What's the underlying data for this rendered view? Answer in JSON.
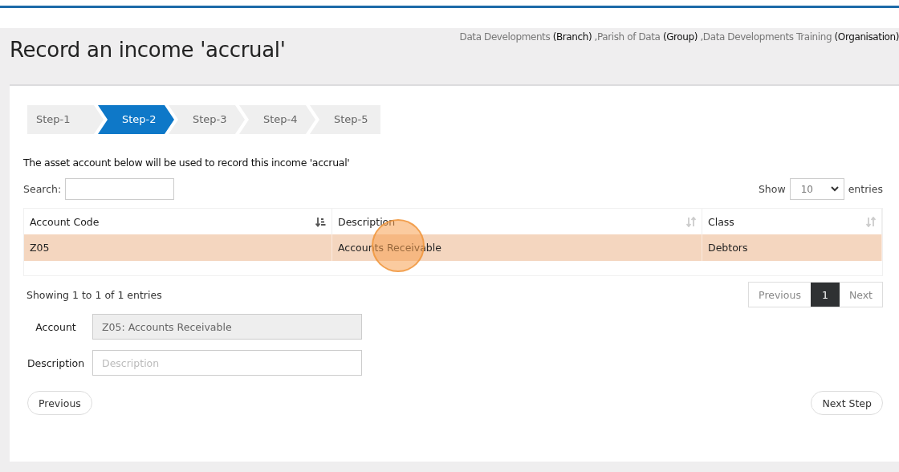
{
  "page": {
    "title": "Record an income 'accrual'"
  },
  "breadcrumb": [
    {
      "name": "Data Developments",
      "type": "(Branch)",
      "separator": ","
    },
    {
      "name": "Parish of Data",
      "type": "(Group)",
      "separator": ","
    },
    {
      "name": "Data Developments Training",
      "type": "(Organisation)"
    }
  ],
  "steps": [
    {
      "label": "Step-1",
      "selected": false
    },
    {
      "label": "Step-2",
      "selected": true
    },
    {
      "label": "Step-3",
      "selected": false
    },
    {
      "label": "Step-4",
      "selected": false
    },
    {
      "label": "Step-5",
      "selected": false
    }
  ],
  "intro": "The asset account below will be used to record this income 'accrual'",
  "search": {
    "label": "Search:"
  },
  "length": {
    "before": "Show",
    "value": "10",
    "after": "entries"
  },
  "table": {
    "columns": [
      {
        "label": "Account Code",
        "sorted": true
      },
      {
        "label": "Description",
        "sorted": false
      },
      {
        "label": "Class",
        "sorted": false
      }
    ],
    "rows": [
      {
        "cells": [
          "Z05",
          "Accounts Receivable",
          "Debtors"
        ],
        "selected": true
      }
    ]
  },
  "info": "Showing 1 to 1 of 1 entries",
  "pagination": {
    "previous": "Previous",
    "next": "Next",
    "pages": [
      {
        "label": "1",
        "selected": true
      }
    ]
  },
  "form": [
    {
      "label": "Account",
      "value": "Z05: Accounts Receivable",
      "disabled": true
    },
    {
      "label": "Description",
      "placeholder": "Description",
      "disabled": false
    }
  ],
  "buttons": {
    "previous": "Previous",
    "next": "Next Step"
  }
}
